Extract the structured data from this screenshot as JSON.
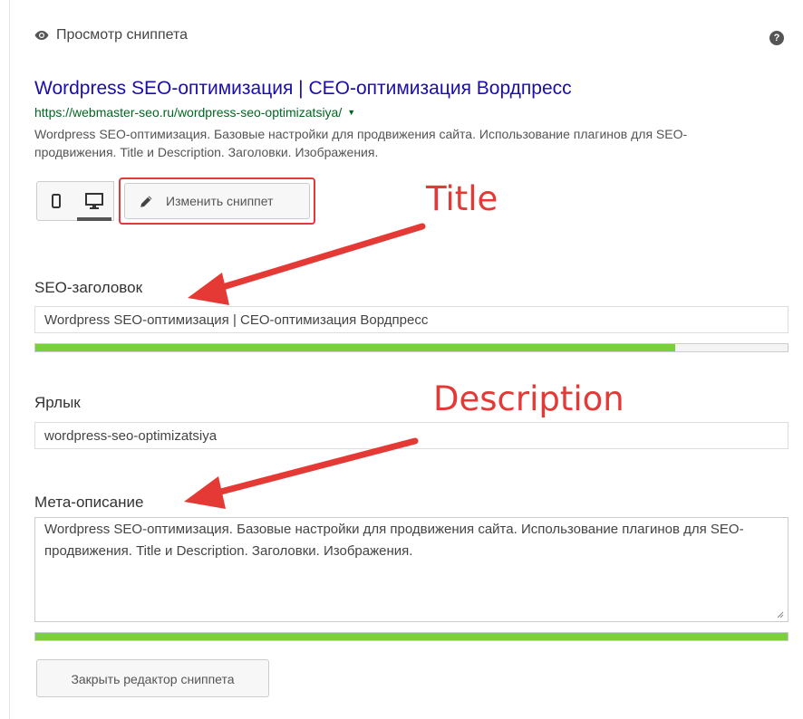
{
  "header": {
    "title": "Просмотр сниппета",
    "help_glyph": "?"
  },
  "snippet": {
    "title": "Wordpress SEO-оптимизация | СЕО-оптимизация Вордпресс",
    "url": "https://webmaster-seo.ru/wordpress-seo-optimizatsiya/",
    "url_arrow": "▼",
    "description": "Wordpress SEO-оптимизация. Базовые настройки для продвижения сайта. Использование плагинов для SEO-продвижения. Title и Description. Заголовки. Изображения."
  },
  "preview_modes": {
    "selected": "desktop",
    "icons": [
      "mobile-icon",
      "desktop-icon"
    ]
  },
  "edit_snippet_label": "Изменить сниппет",
  "fields": {
    "seo_title": {
      "label": "SEO-заголовок",
      "value": "Wordpress SEO-оптимизация | СЕО-оптимизация Вордпресс",
      "progress": 0.85
    },
    "slug": {
      "label": "Ярлык",
      "value": "wordpress-seo-optimizatsiya"
    },
    "meta_description": {
      "label": "Мета-описание",
      "value": "Wordpress SEO-оптимизация. Базовые настройки для продвижения сайта. Использование плагинов для SEO-продвижения. Title и Description. Заголовки. Изображения.",
      "progress": 1.0
    }
  },
  "close_button_label": "Закрыть редактор сниппета",
  "annotations": {
    "title_note": "Title",
    "description_note": "Description"
  },
  "colors": {
    "link": "#1a0dab",
    "url": "#006621",
    "progress_good": "#7ad03a",
    "annotation": "#e53935"
  }
}
